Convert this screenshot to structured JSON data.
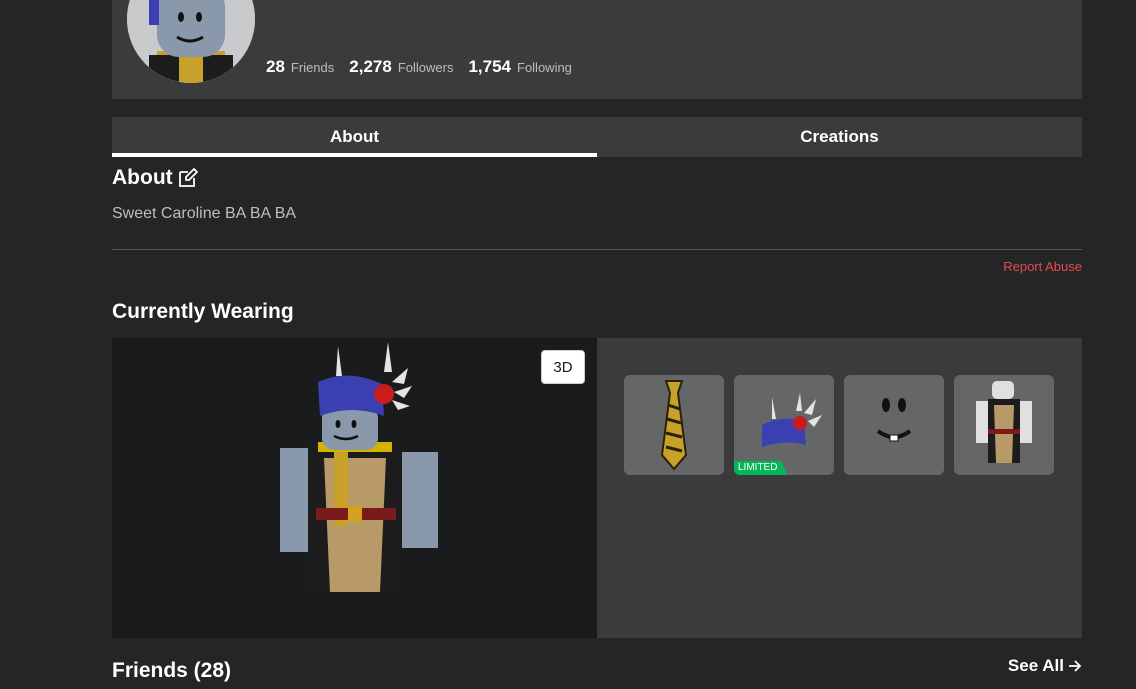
{
  "stats": [
    {
      "value": "28",
      "label": "Friends"
    },
    {
      "value": "2,278",
      "label": "Followers"
    },
    {
      "value": "1,754",
      "label": "Following"
    }
  ],
  "tabs": [
    {
      "label": "About",
      "active": true
    },
    {
      "label": "Creations",
      "active": false
    }
  ],
  "about": {
    "heading": "About",
    "bio": "Sweet Caroline BA BA BA",
    "report_label": "Report Abuse"
  },
  "wearing": {
    "heading": "Currently Wearing",
    "view_toggle_label": "3D",
    "items": [
      {
        "icon": "tie-icon"
      },
      {
        "icon": "winged-hat-icon",
        "badge": "LIMITED"
      },
      {
        "icon": "smile-face-icon"
      },
      {
        "icon": "jacket-shirt-icon"
      }
    ]
  },
  "friends": {
    "heading": "Friends (28)",
    "see_all_label": "See All"
  },
  "colors": {
    "background": "#232527",
    "card": "#393b3d",
    "report": "#e84a4a",
    "limited": "#02b757"
  }
}
